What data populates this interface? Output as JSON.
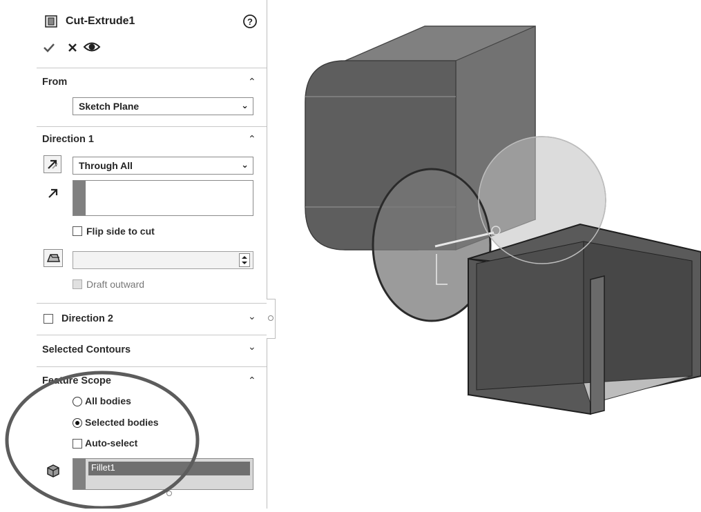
{
  "header": {
    "title": "Cut-Extrude1",
    "help_icon": "?"
  },
  "toolbar": {
    "ok_icon": "check-icon",
    "cancel_icon": "close-icon",
    "preview_icon": "eye-icon"
  },
  "from": {
    "title": "From",
    "selected": "Sketch Plane"
  },
  "direction1": {
    "title": "Direction 1",
    "end_condition": "Through All",
    "flip_side_label": "Flip side to cut",
    "draft_outward_label": "Draft outward"
  },
  "direction2": {
    "title": "Direction 2"
  },
  "selected_contours": {
    "title": "Selected Contours"
  },
  "feature_scope": {
    "title": "Feature Scope",
    "all_bodies_label": "All bodies",
    "selected_bodies_label": "Selected bodies",
    "auto_select_label": "Auto-select",
    "selected_body": "Fillet1"
  },
  "colors": {
    "highlight": "#7a7a7a",
    "model_dark": "#5e5e5e",
    "accent_bar": "#808080"
  }
}
